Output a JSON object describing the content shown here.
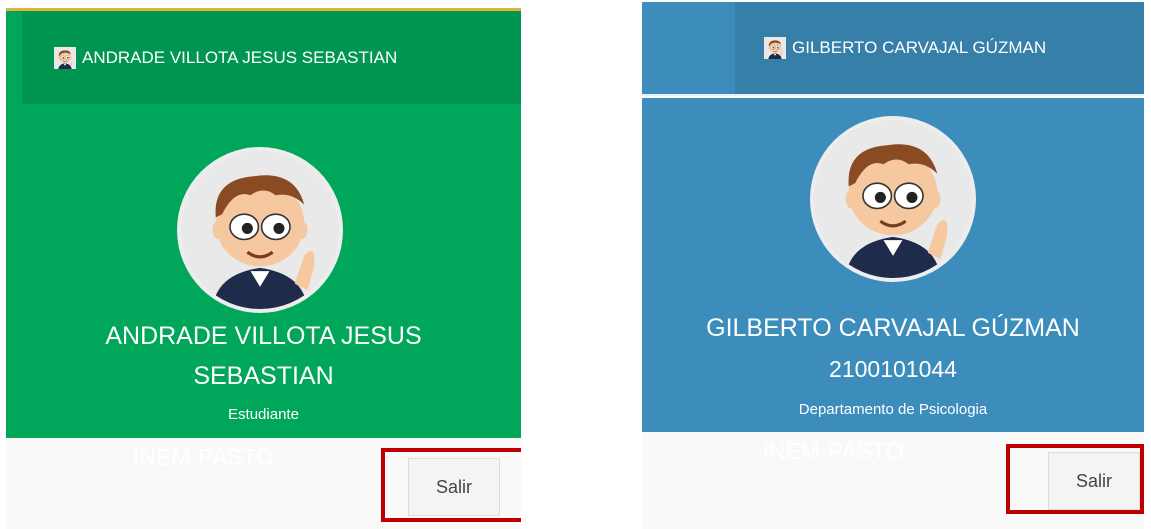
{
  "panels": [
    {
      "theme": "green",
      "colors": {
        "header": "#00a65a",
        "tab": "#009551",
        "top_border": "#e3b43a"
      },
      "header_name": "ANDRADE VILLOTA JESUS SEBASTIAN",
      "user_name": "ANDRADE VILLOTA JESUS SEBASTIAN",
      "role": "Estudiante",
      "institution": "INEM-PASTO",
      "logout_label": "Salir",
      "avatar_icon": "cartoon-boy-avatar"
    },
    {
      "theme": "blue",
      "colors": {
        "header": "#3c8dbc",
        "tab": "#367fa9"
      },
      "header_name": "GILBERTO CARVAJAL GÚZMAN",
      "user_name": "GILBERTO CARVAJAL GÚZMAN",
      "code": "2100101044",
      "role": "Departamento de Psicologia",
      "institution": "INEM-PASTO",
      "logout_label": "Salir",
      "avatar_icon": "cartoon-boy-avatar"
    }
  ],
  "highlight_color": "#c00000"
}
